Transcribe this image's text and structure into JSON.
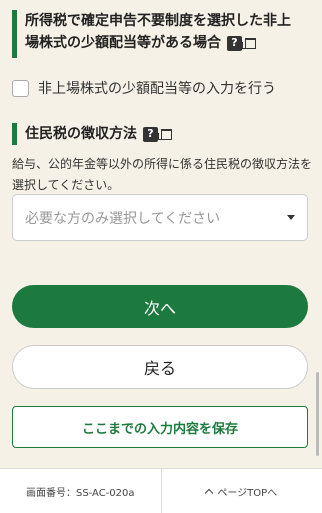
{
  "section1": {
    "title": "所得税で確定申告不要制度を選択した非上場株式の少額配当等がある場合",
    "help": "?",
    "checkbox_label": "非上場株式の少額配当等の入力を行う"
  },
  "section2": {
    "title": "住民税の徴収方法",
    "help": "?",
    "description": "給与、公的年金等以外の所得に係る住民税の徴収方法を選択してください。",
    "select_placeholder": "必要な方のみ選択してください"
  },
  "buttons": {
    "next": "次へ",
    "back": "戻る",
    "save": "ここまでの入力内容を保存"
  },
  "footer": {
    "screen_id": "画面番号：SS-AC-020a",
    "page_top": "ページTOPへ"
  }
}
